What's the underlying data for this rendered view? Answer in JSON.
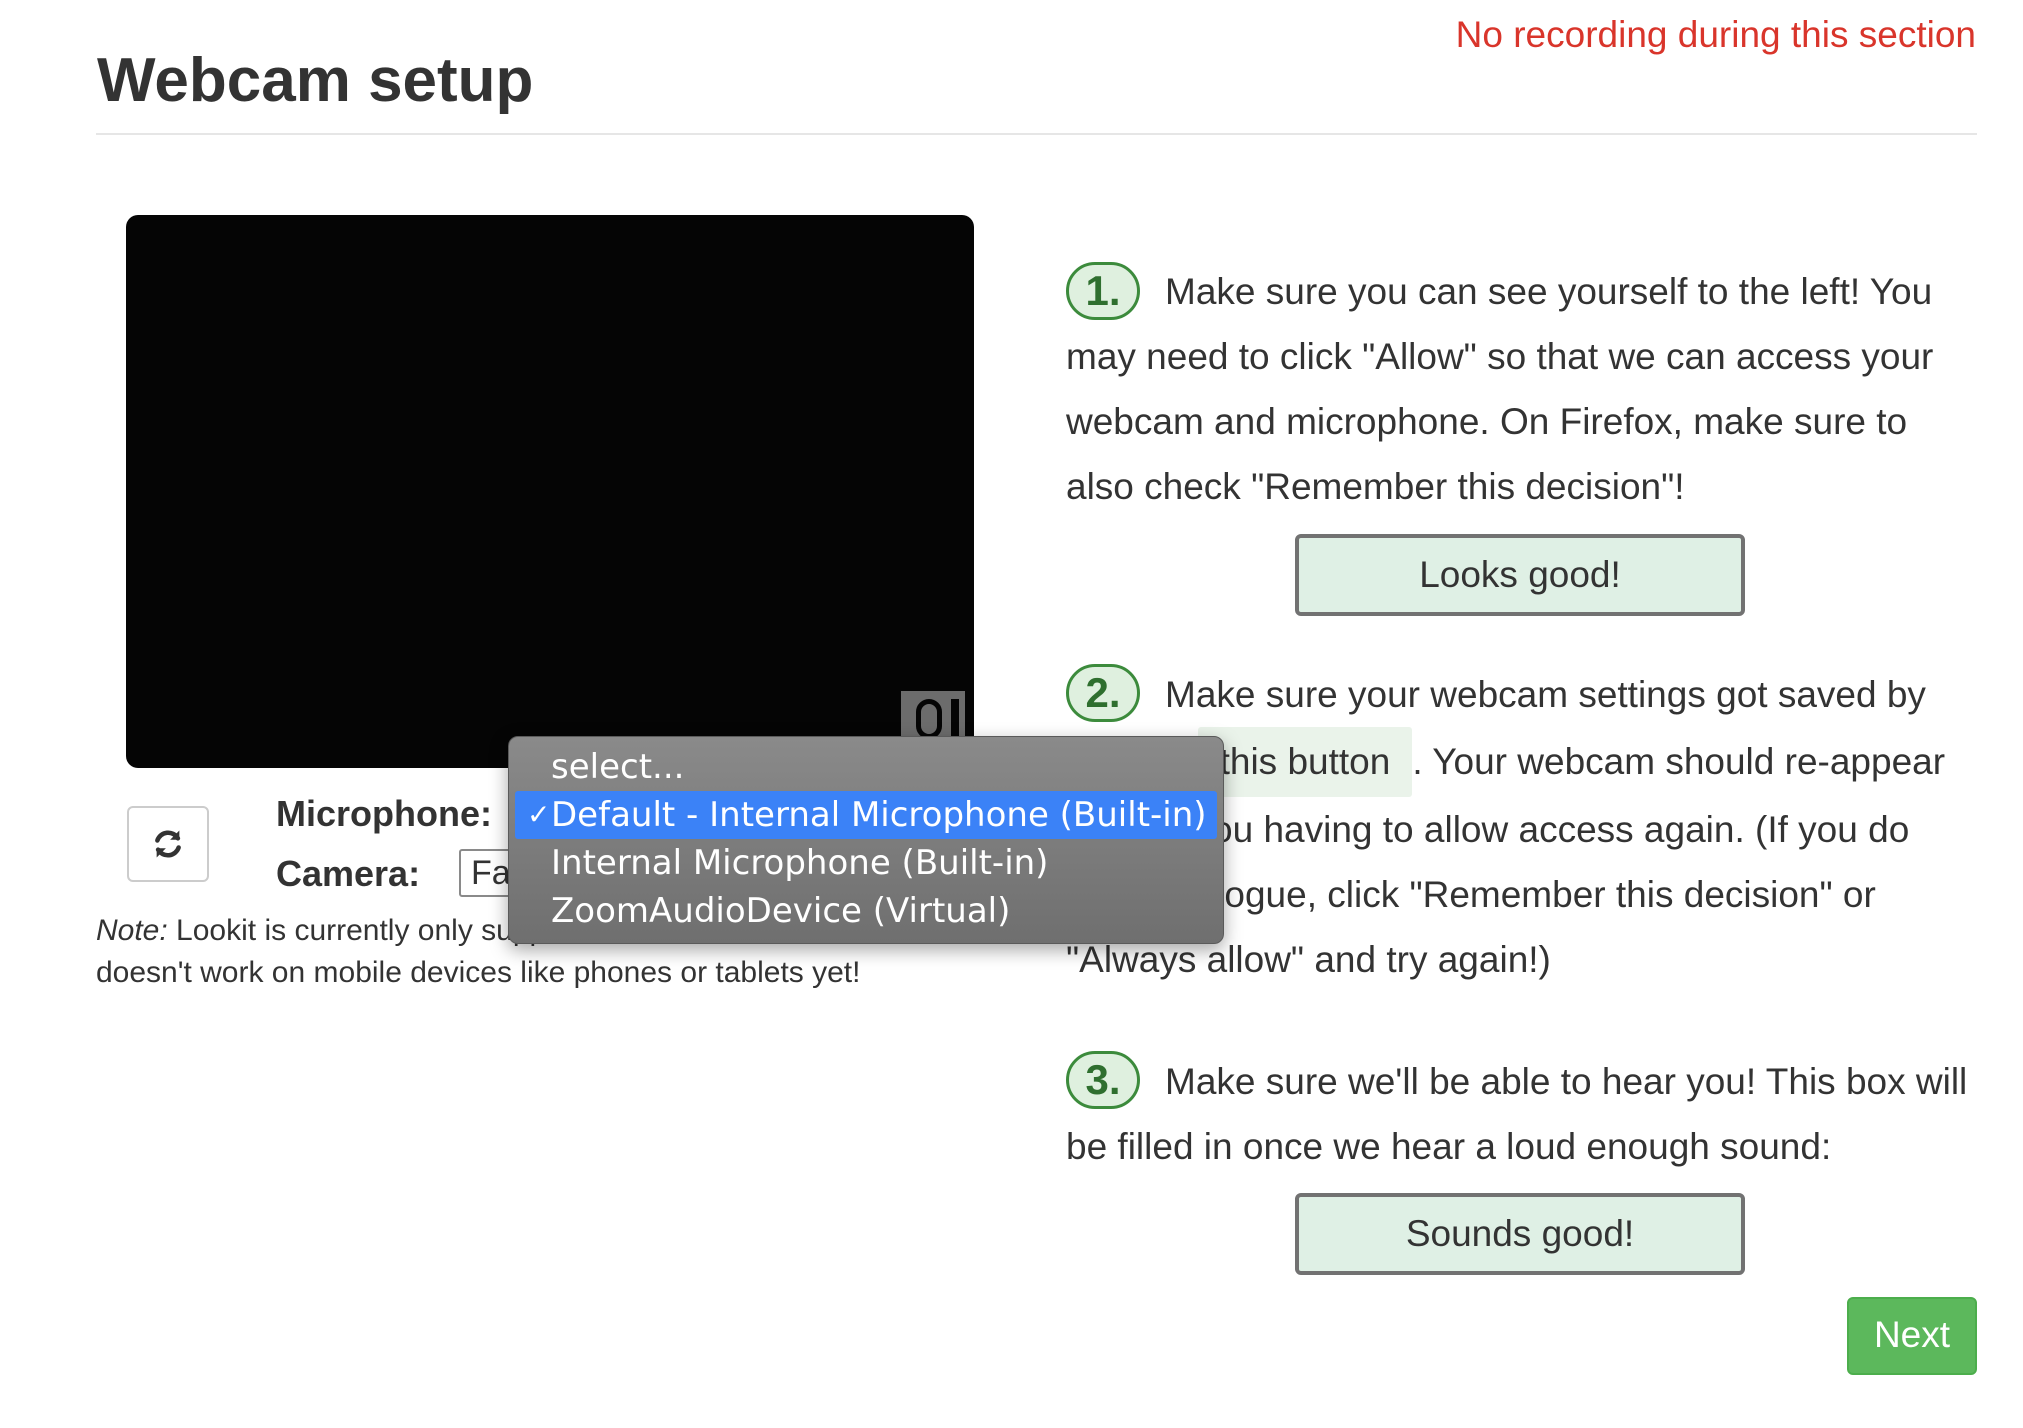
{
  "header": {
    "title": "Webcam setup",
    "recording_notice": "No recording during this section"
  },
  "devices": {
    "microphone_label": "Microphone:",
    "camera_label": "Camera:",
    "camera_selected_value": "FaceTime HD Camera",
    "microphone_options": [
      {
        "label": "select...",
        "selected": false
      },
      {
        "label": "Default - Internal Microphone (Built-in)",
        "selected": true
      },
      {
        "label": "Internal Microphone (Built-in)",
        "selected": false
      },
      {
        "label": "ZoomAudioDevice (Virtual)",
        "selected": false
      }
    ],
    "selected_check": "✓"
  },
  "note": {
    "prefix": "Note:",
    "text": " Lookit is currently only supported on Firefox and Chrome. It doesn't work on mobile devices like phones or tablets yet!"
  },
  "steps": [
    {
      "number": "1.",
      "text": "Make sure you can see yourself to the left! You may need to click \"Allow\" so that we can access your webcam and microphone. On Firefox, make sure to also check \"Remember this decision\"!",
      "button": "Looks good!"
    },
    {
      "number": "2.",
      "text_before": "Make sure your webcam settings got saved by clicking",
      "inline_button": "this button",
      "text_after": ". Your webcam should re-appear without you having to allow access again. (If you do see a dialogue, click \"Remember this decision\" or \"Always allow\" and try again!)"
    },
    {
      "number": "3.",
      "text": "Make sure we'll be able to hear you! This box will be filled in once we hear a loud enough sound:",
      "button": "Sounds good!"
    }
  ],
  "next_button": "Next",
  "colors": {
    "recording_notice": "#d9352b",
    "step_badge_border": "#3c8b3c",
    "step_badge_fill": "#dff0df",
    "action_button_fill": "#dff0e5",
    "next_button": "#5cb85c",
    "dropdown_highlight": "#3b82f7"
  },
  "icons": {
    "refresh": "refresh-icon",
    "mic_meter": "microphone-level-icon"
  }
}
